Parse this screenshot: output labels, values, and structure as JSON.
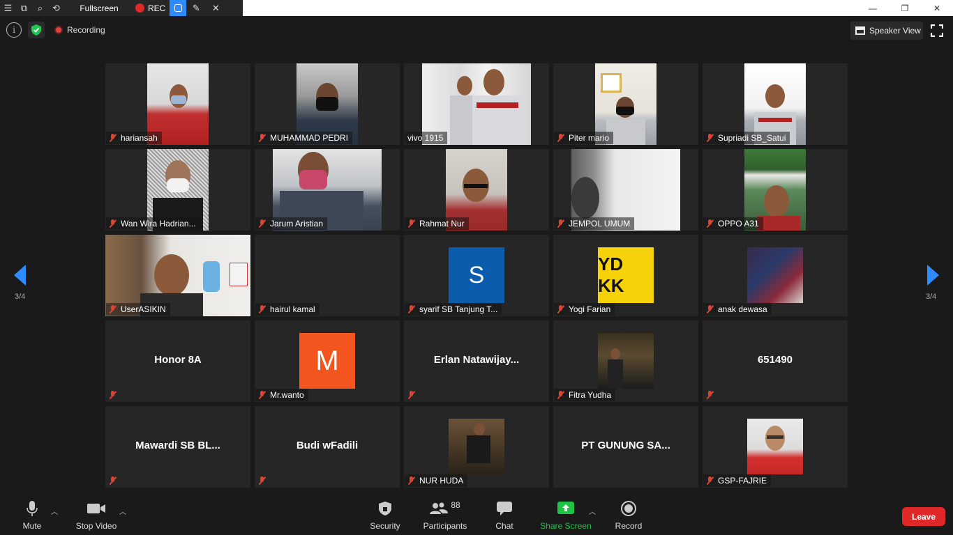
{
  "titlebar": {
    "fullscreen_label": "Fullscreen",
    "rec_label": "REC"
  },
  "infobar": {
    "recording_label": "Recording",
    "speaker_view_label": "Speaker View",
    "info_glyph": "i"
  },
  "pagination": {
    "left": "3/4",
    "right": "3/4"
  },
  "participants": [
    {
      "name": "hariansah"
    },
    {
      "name": "MUHAMMAD PEDRI"
    },
    {
      "name": "vivo 1915"
    },
    {
      "name": "Piter mario"
    },
    {
      "name": "Supriadi SB_Satui"
    },
    {
      "name": "Wan Wira Hadrian..."
    },
    {
      "name": "Jarum Aristian"
    },
    {
      "name": "Rahmat Nur"
    },
    {
      "name": "JEMPOL UMUM"
    },
    {
      "name": "OPPO A31"
    },
    {
      "name": "UserASIKIN"
    },
    {
      "name": "hairul kamal"
    },
    {
      "name": "syarif SB Tanjung T...",
      "avatar_text": "S",
      "avatar_color": "#0b5cad"
    },
    {
      "name": "Yogi Farian",
      "avatar_text": "YD KK",
      "avatar_color": "#f5d20a"
    },
    {
      "name": "anak dewasa"
    },
    {
      "display": "Honor 8A"
    },
    {
      "name": "Mr.wanto",
      "avatar_text": "M",
      "avatar_color": "#f2551e"
    },
    {
      "display": "Erlan  Natawijay..."
    },
    {
      "name": "Fitra Yudha"
    },
    {
      "display": "651490"
    },
    {
      "display": "Mawardi  SB  BL..."
    },
    {
      "display": "Budi wFadili"
    },
    {
      "name": "NUR HUDA"
    },
    {
      "display": "PT GUNUNG SA..."
    },
    {
      "name": "GSP-FAJRIE"
    }
  ],
  "toolbar": {
    "mute_label": "Mute",
    "stop_video_label": "Stop Video",
    "security_label": "Security",
    "participants_label": "Participants",
    "participants_count": "88",
    "chat_label": "Chat",
    "share_screen_label": "Share Screen",
    "record_label": "Record",
    "leave_label": "Leave"
  },
  "colors": {
    "accent": "#2d8cff",
    "leave": "#e02828",
    "share": "#1fc346",
    "muted": "#dd4433"
  }
}
